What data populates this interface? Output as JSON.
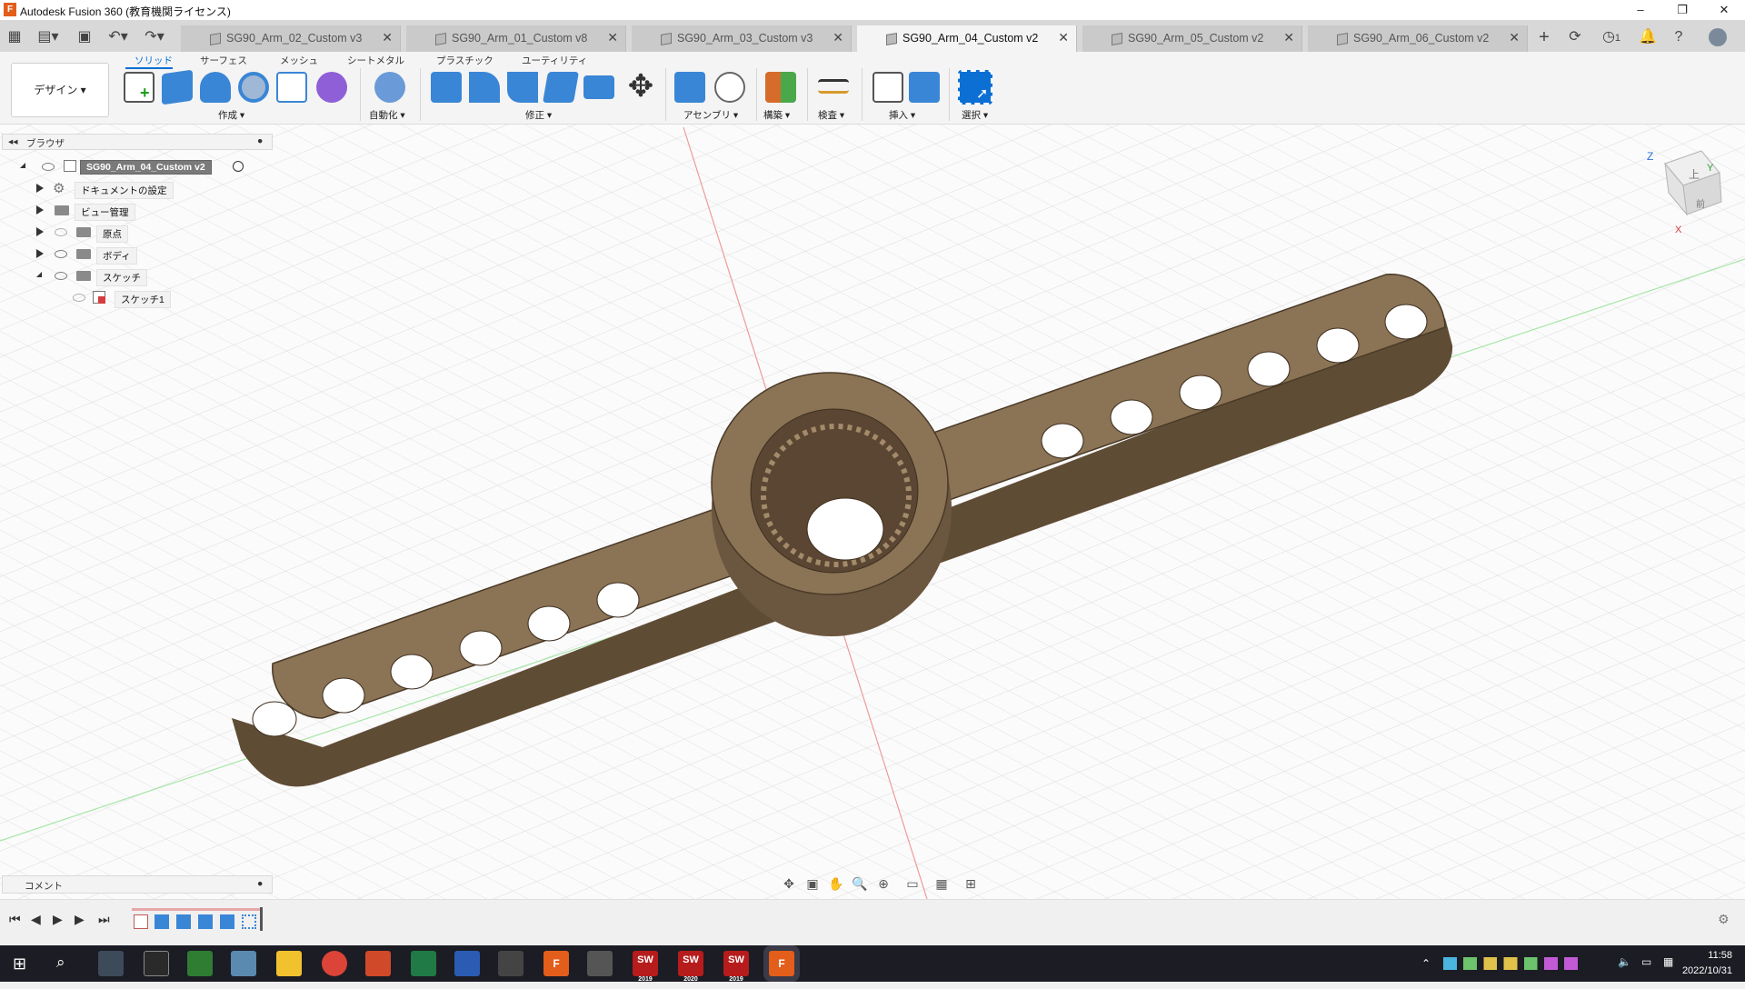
{
  "app": {
    "title": "Autodesk Fusion 360 (教育機関ライセンス)",
    "logo": "F"
  },
  "window_controls": {
    "minimize": "–",
    "restore": "❐",
    "close": "✕"
  },
  "tabs": [
    {
      "label": "SG90_Arm_02_Custom v3",
      "active": false
    },
    {
      "label": "SG90_Arm_01_Custom v8",
      "active": false
    },
    {
      "label": "SG90_Arm_03_Custom v3",
      "active": false
    },
    {
      "label": "SG90_Arm_04_Custom v2",
      "active": true
    },
    {
      "label": "SG90_Arm_05_Custom v2",
      "active": false
    },
    {
      "label": "SG90_Arm_06_Custom v2",
      "active": false
    }
  ],
  "tab_close": "✕",
  "tabbar_right": {
    "add": "+",
    "job_count": "1"
  },
  "ribbon": {
    "tabs": [
      "ソリッド",
      "サーフェス",
      "メッシュ",
      "シートメタル",
      "プラスチック",
      "ユーティリティ"
    ],
    "workspace": "デザイン ▾",
    "groups": [
      "作成 ▾",
      "自動化 ▾",
      "修正 ▾",
      "アセンブリ ▾",
      "構築 ▾",
      "検査 ▾",
      "挿入 ▾",
      "選択 ▾"
    ]
  },
  "browser": {
    "header": "ブラウザ",
    "root": "SG90_Arm_04_Custom v2",
    "nodes": [
      "ドキュメントの設定",
      "ビュー管理",
      "原点",
      "ボディ",
      "スケッチ"
    ],
    "sketch_child": "スケッチ1"
  },
  "comment": {
    "label": "コメント"
  },
  "viewcube": {
    "top": "上",
    "front": "前",
    "z": "Z",
    "y": "Y",
    "x": "X"
  },
  "taskbar": {
    "apps": [
      "F",
      "SW",
      "SW",
      "SW",
      "F"
    ],
    "sw_versions": [
      "2019",
      "2020",
      "2019"
    ],
    "time": "11:58",
    "date": "2022/10/31"
  },
  "colors": {
    "accent": "#0b6fd4",
    "model": "#8b7355",
    "model_shadow": "#5f4c35",
    "grid": "#d7d7d7"
  }
}
